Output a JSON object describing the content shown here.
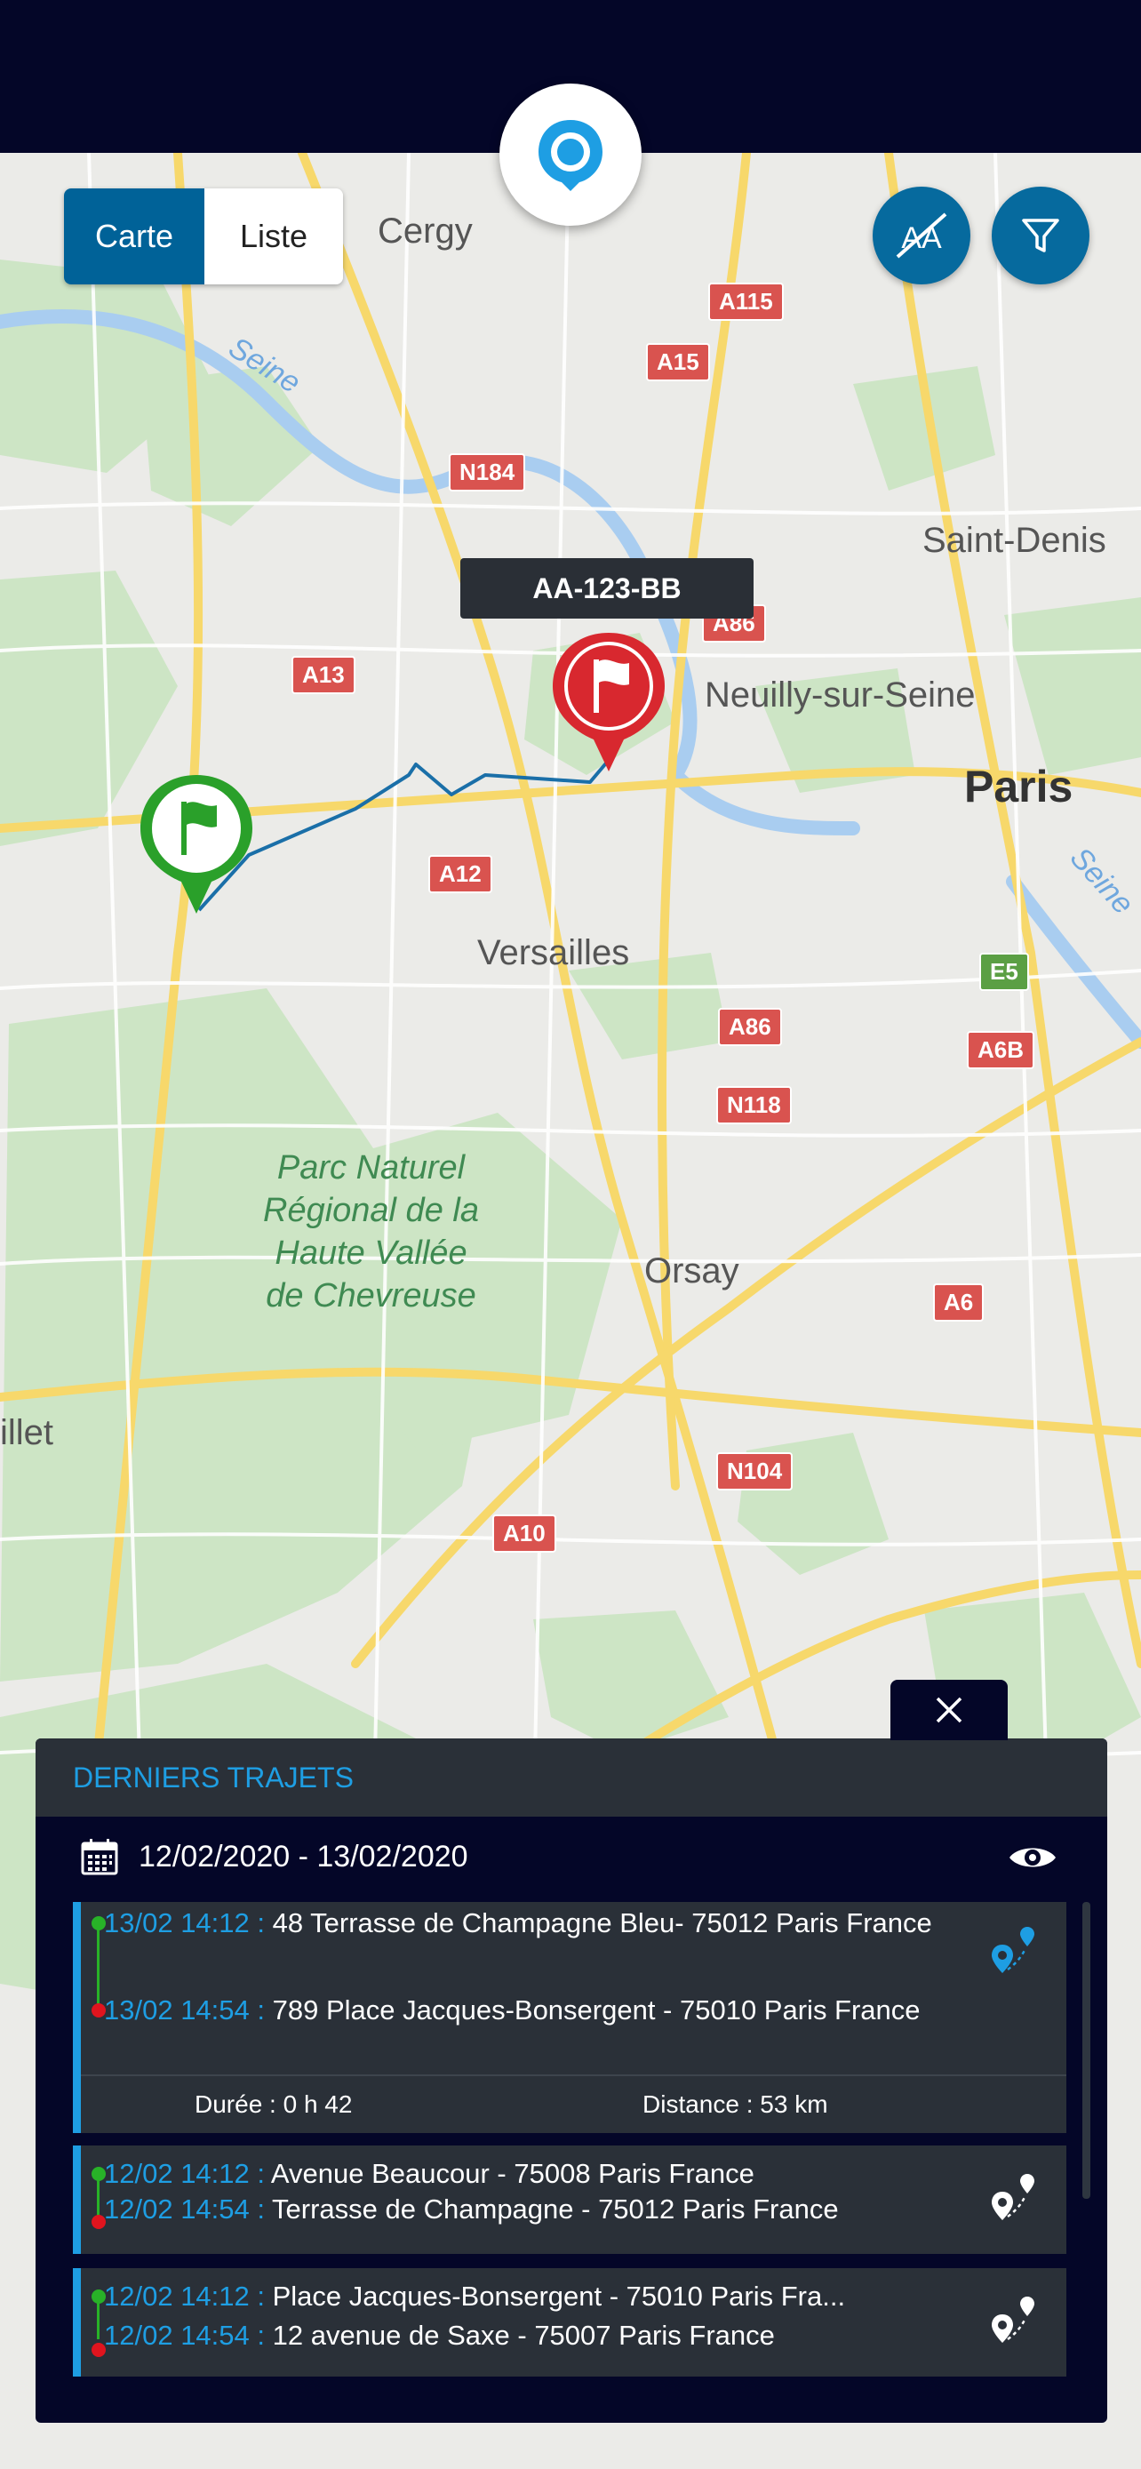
{
  "toggle": {
    "map_label": "Carte",
    "list_label": "Liste"
  },
  "vehicle": {
    "plate": "AA-123-BB"
  },
  "map_places": {
    "cergy": "Cergy",
    "saint_denis": "Saint-Denis",
    "neuilly": "Neuilly-sur-Seine",
    "paris": "Paris",
    "versailles": "Versailles",
    "park": "Parc Naturel\nRégional de la\nHaute Vallée\nde Chevreuse",
    "orsay": "Orsay",
    "illet": "illet",
    "seine_west": "Seine",
    "seine_east": "Seine"
  },
  "roads": {
    "a115": "A115",
    "a15": "A15",
    "n184": "N184",
    "a86_n": "A86",
    "a13": "A13",
    "a12": "A12",
    "e5": "E5",
    "a86_s": "A86",
    "a6b": "A6B",
    "n118": "N118",
    "a6": "A6",
    "n104": "N104",
    "a10": "A10"
  },
  "panel": {
    "title": "DERNIERS TRAJETS",
    "date_range": "12/02/2020 - 13/02/2020",
    "trips": [
      {
        "start_time": "13/02 14:12 : ",
        "start_address": "48 Terrasse de Champagne Bleu- 75012 Paris France",
        "end_time": "13/02 14:54 : ",
        "end_address": "789 Place Jacques-Bonsergent  - 75010 Paris France",
        "duration": "Durée : 0 h 42",
        "distance": "Distance : 53 km"
      },
      {
        "start_time": "12/02 14:12 : ",
        "start_address": "Avenue Beaucour - 75008 Paris France",
        "end_time": "12/02 14:54 : ",
        "end_address": "Terrasse de Champagne - 75012 Paris France"
      },
      {
        "start_time": "12/02 14:12 : ",
        "start_address": "Place Jacques-Bonsergent  - 75010 Paris Fra...",
        "end_time": "12/02 14:54 : ",
        "end_address": "12 avenue de Saxe - 75007 Paris France"
      }
    ]
  },
  "colors": {
    "navy": "#040628",
    "accent": "#1e9ee3",
    "button_blue": "#066a9e",
    "start_flag": "#2aa02a",
    "end_flag": "#d8282f",
    "route": "#1a6fa8"
  },
  "icons": [
    "location-icon",
    "hide-plates-icon",
    "filter-icon",
    "start-flag-icon",
    "end-flag-icon",
    "close-icon",
    "calendar-icon",
    "eye-icon",
    "trip-route-icon"
  ]
}
